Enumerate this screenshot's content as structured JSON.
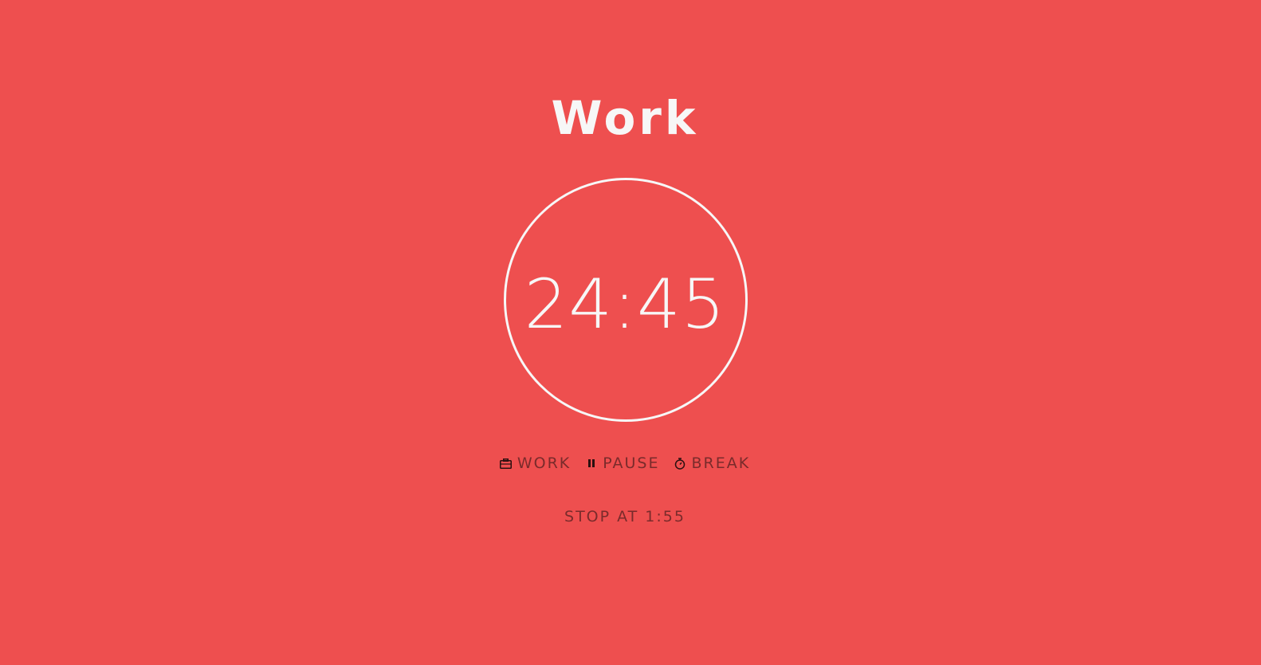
{
  "theme": {
    "background": "#ee4f4f",
    "primary_text": "#f7f7f7",
    "secondary_text": "#7a2b2b"
  },
  "timer": {
    "mode_title": "Work",
    "remaining": "24:45"
  },
  "controls": [
    {
      "label": "WORK",
      "icon": "briefcase-icon"
    },
    {
      "label": "PAUSE",
      "icon": "pause-icon"
    },
    {
      "label": "BREAK",
      "icon": "stopwatch-icon"
    }
  ],
  "stop_at": {
    "label": "STOP AT 1:55"
  }
}
